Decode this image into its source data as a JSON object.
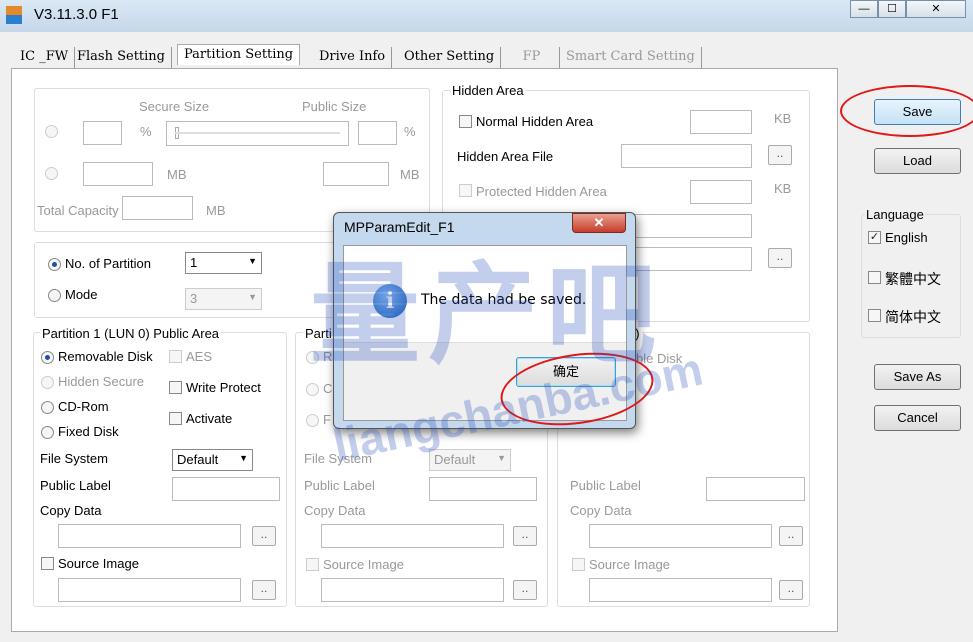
{
  "window": {
    "title": "V3.11.3.0 F1",
    "min": "—",
    "max": "☐",
    "close": "✕"
  },
  "tabs": [
    {
      "label": "IC _FW"
    },
    {
      "label": "Flash Setting"
    },
    {
      "label": "Partition Setting"
    },
    {
      "label": "Drive Info"
    },
    {
      "label": "Other Setting"
    },
    {
      "label": "FP"
    },
    {
      "label": "Smart Card Setting"
    }
  ],
  "capacity": {
    "secure_size": "Secure Size",
    "public_size": "Public Size",
    "pct": "%",
    "mb": "MB",
    "total_capacity": "Total Capacity"
  },
  "partition": {
    "no_of_partition": "No. of Partition",
    "no_value": "1",
    "mode": "Mode",
    "mode_value": "3"
  },
  "hidden": {
    "title": "Hidden Area",
    "normal": "Normal Hidden Area",
    "kb": "KB",
    "file": "Hidden Area File",
    "protected": "Protected Hidden Area",
    "browse": ".."
  },
  "p1": {
    "title": "Partition 1 (LUN 0) Public Area",
    "removable": "Removable Disk",
    "aes": "AES",
    "hidden_secure": "Hidden Secure",
    "write_protect": "Write Protect",
    "cdrom": "CD-Rom",
    "activate": "Activate",
    "fixed": "Fixed Disk",
    "file_system": "File System",
    "fs_value": "Default",
    "public_label": "Public Label",
    "copy_data": "Copy Data",
    "source_image": "Source Image"
  },
  "p2": {
    "title": "Parti",
    "r1": "R",
    "r2": "C",
    "r3": "F",
    "file_system": "File System",
    "fs_value": "Default",
    "public_label": "Public Label",
    "copy_data": "Copy Data",
    "source_image": "Source Image"
  },
  "p3": {
    "title": "2)",
    "removable": "ble Disk",
    "public_label": "Public Label",
    "copy_data": "Copy Data",
    "source_image": "Source Image"
  },
  "right": {
    "save": "Save",
    "load": "Load",
    "language": "Language",
    "english": "English",
    "trad": "繁體中文",
    "simp": "简体中文",
    "save_as": "Save As",
    "cancel": "Cancel"
  },
  "dialog": {
    "title": "MPParamEdit_F1",
    "message": "The data had be saved.",
    "ok": "确定",
    "close": "✕",
    "icon": "info-icon"
  },
  "watermark": {
    "text": "量产吧",
    "url": "liangchanba.com"
  },
  "colors": {
    "highlight": "#e01818",
    "accent": "#1f4fa6"
  }
}
